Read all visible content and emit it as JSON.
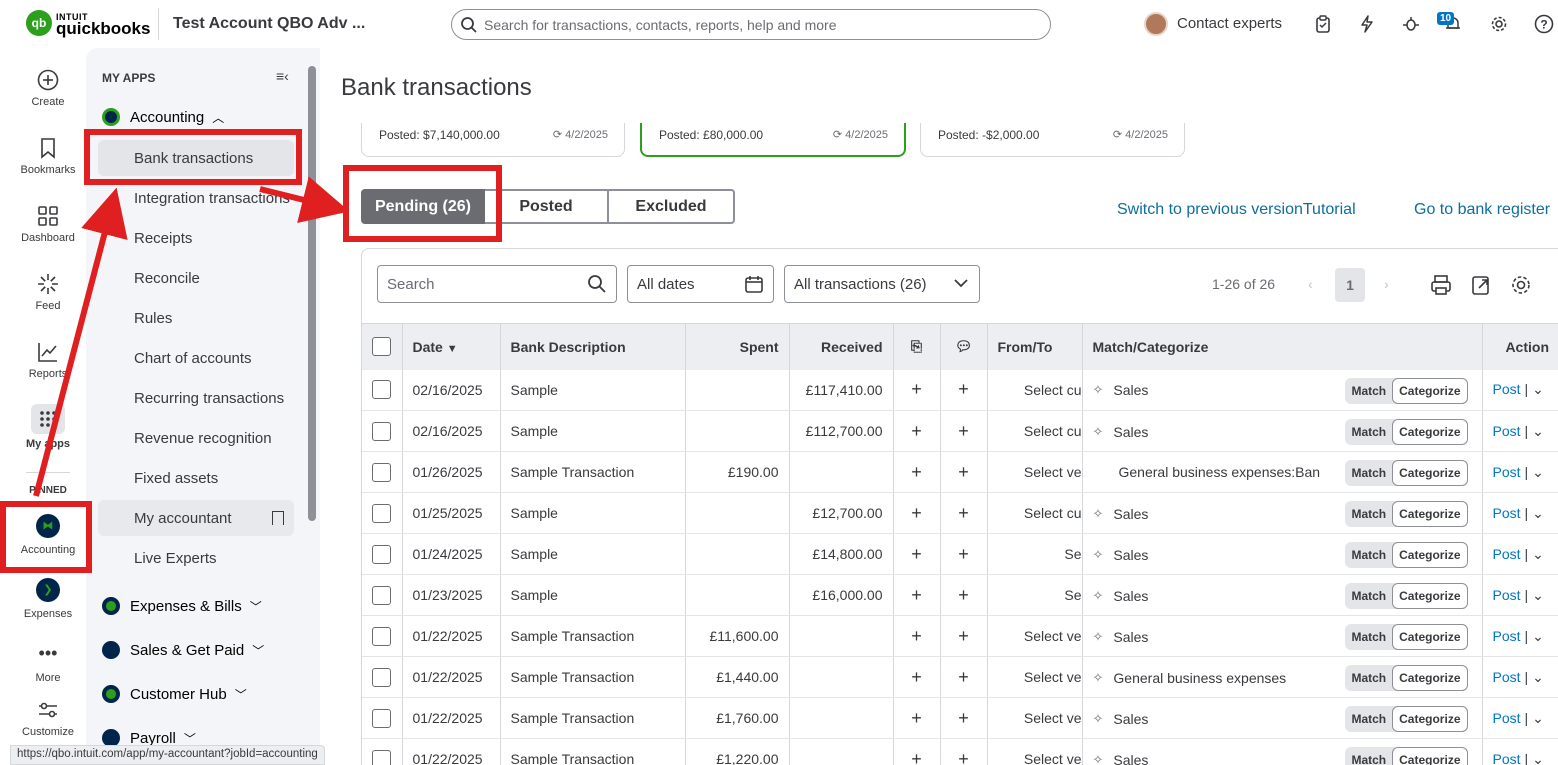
{
  "topbar": {
    "logo_brand": "INTUIT",
    "logo_product": "quickbooks",
    "company": "Test Account QBO Adv ...",
    "search_placeholder": "Search for transactions, contacts, reports, help and more",
    "contact": "Contact experts",
    "notification_count": "10",
    "icons": [
      "checklist-icon",
      "lightning-icon",
      "bug-icon",
      "notification-icon",
      "gear-icon",
      "help-icon"
    ]
  },
  "rail": {
    "items": [
      "Create",
      "Bookmarks",
      "Dashboard",
      "Feed",
      "Reports",
      "My apps"
    ],
    "pinned_label": "PINNED",
    "pinned": [
      "Accounting",
      "Expenses",
      "More",
      "Customize"
    ]
  },
  "menu": {
    "heading": "MY APPS",
    "sections": {
      "accounting": "Accounting",
      "expenses": "Expenses & Bills",
      "sales": "Sales & Get Paid",
      "customer": "Customer Hub",
      "payroll": "Payroll"
    },
    "items": [
      "Bank transactions",
      "Integration transactions",
      "Receipts",
      "Reconcile",
      "Rules",
      "Chart of accounts",
      "Recurring transactions",
      "Revenue recognition",
      "Fixed assets",
      "My accountant",
      "Live Experts"
    ]
  },
  "page": {
    "title": "Bank transactions",
    "cards": [
      {
        "posted": "Posted: $7,140,000.00",
        "date": "4/2/2025"
      },
      {
        "posted": "Posted: £80,000.00",
        "date": "4/2/2025"
      },
      {
        "posted": "Posted: -$2,000.00",
        "date": "4/2/2025"
      }
    ],
    "tabs": [
      "Pending (26)",
      "Posted",
      "Excluded"
    ],
    "links": {
      "switch": "Switch to previous versionTutorial",
      "register": "Go to bank register"
    },
    "search_placeholder": "Search",
    "date_filter": "All dates",
    "txn_filter": "All transactions (26)",
    "pager_text": "1-26 of 26",
    "page_num": "1"
  },
  "table": {
    "headers": [
      "Date",
      "Bank Description",
      "Spent",
      "Received",
      "From/To",
      "Match/Categorize",
      "Action"
    ],
    "match_label": "Match",
    "categorize_label": "Categorize",
    "post_label": "Post",
    "rows": [
      {
        "date": "02/16/2025",
        "desc": "Sample",
        "spent": "",
        "received": "£117,410.00",
        "fromto": "Select cu",
        "cat": "Sales",
        "icon": true
      },
      {
        "date": "02/16/2025",
        "desc": "Sample",
        "spent": "",
        "received": "£112,700.00",
        "fromto": "Select cu",
        "cat": "Sales",
        "icon": true
      },
      {
        "date": "01/26/2025",
        "desc": "Sample Transaction",
        "spent": "£190.00",
        "received": "",
        "fromto": "Select ve",
        "cat": "General business expenses:Ban",
        "icon": false
      },
      {
        "date": "01/25/2025",
        "desc": "Sample",
        "spent": "",
        "received": "£12,700.00",
        "fromto": "Select cu",
        "cat": "Sales",
        "icon": true
      },
      {
        "date": "01/24/2025",
        "desc": "Sample",
        "spent": "",
        "received": "£14,800.00",
        "fromto": "Se",
        "cat": "Sales",
        "icon": true
      },
      {
        "date": "01/23/2025",
        "desc": "Sample",
        "spent": "",
        "received": "£16,000.00",
        "fromto": "Se",
        "cat": "Sales",
        "icon": true
      },
      {
        "date": "01/22/2025",
        "desc": "Sample Transaction",
        "spent": "£11,600.00",
        "received": "",
        "fromto": "Select ve",
        "cat": "Sales",
        "icon": true
      },
      {
        "date": "01/22/2025",
        "desc": "Sample Transaction",
        "spent": "£1,440.00",
        "received": "",
        "fromto": "Select ve",
        "cat": "General business expenses",
        "icon": true
      },
      {
        "date": "01/22/2025",
        "desc": "Sample Transaction",
        "spent": "£1,760.00",
        "received": "",
        "fromto": "Select ve",
        "cat": "Sales",
        "icon": true
      },
      {
        "date": "01/22/2025",
        "desc": "Sample Transaction",
        "spent": "£1,220.00",
        "received": "",
        "fromto": "Select ve",
        "cat": "Sales",
        "icon": true
      }
    ]
  },
  "status_url": "https://qbo.intuit.com/app/my-accountant?jobId=accounting",
  "colors": {
    "brand_green": "#2ca01c",
    "link_blue": "#0077c5",
    "annotation_red": "#e02020"
  }
}
